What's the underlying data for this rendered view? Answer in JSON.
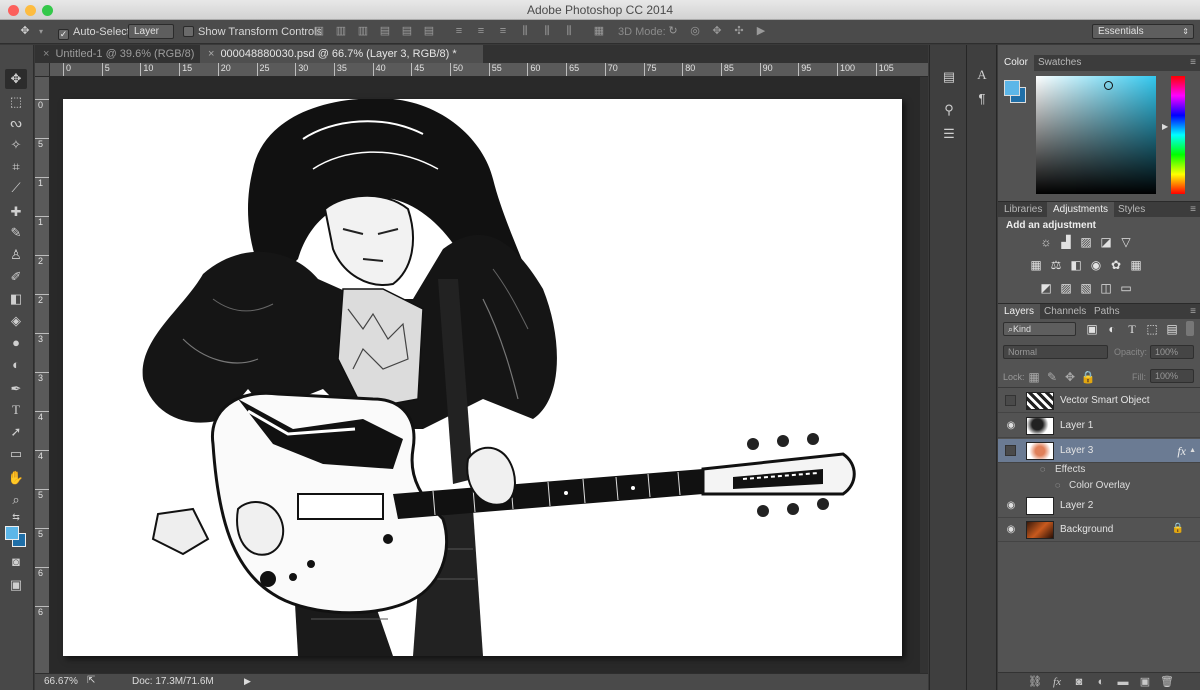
{
  "app": {
    "window_title": "Adobe Photoshop CC 2014",
    "traffic_lights": [
      "#fc605c",
      "#fdbc40",
      "#34c84a"
    ]
  },
  "options_bar": {
    "auto_select_label": "Auto-Select:",
    "auto_select_value": "Layer",
    "show_transform_label": "Show Transform Controls",
    "mode_3d_label": "3D Mode:",
    "workspace": "Essentials"
  },
  "doc_tabs": [
    {
      "label": "Untitled-1 @ 39.6% (RGB/8)",
      "active": false
    },
    {
      "label": "000048880030.psd @ 66.7% (Layer 3, RGB/8) *",
      "active": true
    }
  ],
  "ruler": {
    "h_ticks": [
      "0",
      "5",
      "10",
      "15",
      "20",
      "25",
      "30",
      "35",
      "40",
      "45",
      "50",
      "55",
      "60",
      "65",
      "70",
      "75",
      "80",
      "85",
      "90",
      "95",
      "100",
      "105"
    ],
    "v_ticks": [
      "0",
      "5",
      "1",
      "1",
      "2",
      "2",
      "3",
      "3",
      "4",
      "4",
      "5",
      "5",
      "6",
      "6"
    ]
  },
  "status": {
    "zoom": "66.67%",
    "doc": "Doc: 17.3M/71.6M"
  },
  "color_panel": {
    "tabs": [
      "Color",
      "Swatches"
    ],
    "foreground": "#5cb6e8",
    "background_swatch": "#1f6fa8",
    "picker_hue": "#33c8ef"
  },
  "adjustments_panel": {
    "tabs": [
      "Libraries",
      "Adjustments",
      "Styles"
    ],
    "heading": "Add an adjustment"
  },
  "layers_panel": {
    "tabs": [
      "Layers",
      "Channels",
      "Paths"
    ],
    "filter": "Kind",
    "blend_mode": "Normal",
    "opacity_label": "Opacity:",
    "opacity_value": "100%",
    "lock_label": "Lock:",
    "fill_label": "Fill:",
    "fill_value": "100%",
    "layers": [
      {
        "name": "Vector Smart Object",
        "visible": false,
        "selected": false
      },
      {
        "name": "Layer 1",
        "visible": true,
        "selected": false
      },
      {
        "name": "Layer 3",
        "visible": false,
        "selected": true,
        "fx": "fx"
      },
      {
        "name": "Layer 2",
        "visible": true,
        "selected": false
      },
      {
        "name": "Background",
        "visible": true,
        "selected": false
      }
    ],
    "effects_label": "Effects",
    "effect_item": "Color Overlay"
  }
}
